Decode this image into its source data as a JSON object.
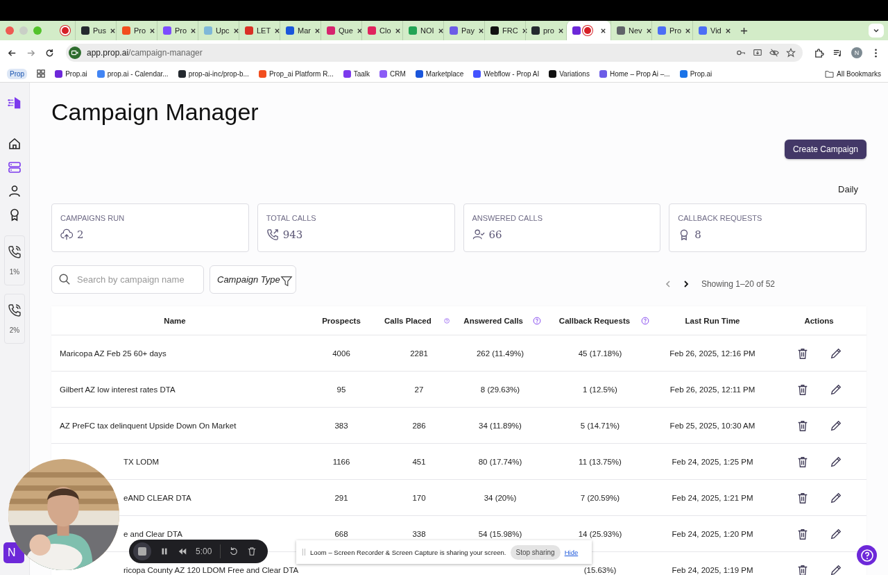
{
  "browser": {
    "tabs": [
      {
        "kind": "recording",
        "selected": false
      },
      {
        "kind": "page",
        "title": "Pus",
        "color": "#24292f",
        "selected": false
      },
      {
        "kind": "page",
        "title": "Pro",
        "color": "#f24e1e",
        "selected": false
      },
      {
        "kind": "page",
        "title": "Pro",
        "color": "#7c4dff",
        "selected": false
      },
      {
        "kind": "page",
        "title": "Upc",
        "color": "#7fb8d8",
        "selected": false
      },
      {
        "kind": "page",
        "title": "LET",
        "color": "#d93025",
        "selected": false
      },
      {
        "kind": "page",
        "title": "Mar",
        "color": "#1a56db",
        "selected": false
      },
      {
        "kind": "page",
        "title": "Que",
        "color": "#d6246e",
        "selected": false
      },
      {
        "kind": "page",
        "title": "Clo",
        "color": "#e0245e",
        "selected": false
      },
      {
        "kind": "page",
        "title": "NOI",
        "color": "#23a455",
        "selected": false
      },
      {
        "kind": "page",
        "title": "Pay",
        "color": "#6c5ce7",
        "selected": false
      },
      {
        "kind": "page",
        "title": "FRC",
        "color": "#111111",
        "selected": false
      },
      {
        "kind": "page",
        "title": "pro",
        "color": "#24292f",
        "selected": false
      },
      {
        "kind": "recording-page",
        "color": "#6d28d9",
        "selected": true
      },
      {
        "kind": "page",
        "title": "Nev",
        "color": "#5f6368",
        "selected": false
      },
      {
        "kind": "page",
        "title": "Pro",
        "color": "#4c6ef5",
        "selected": false
      },
      {
        "kind": "page",
        "title": "Vid",
        "color": "#4c6ef5",
        "selected": false
      }
    ],
    "address": {
      "host": "app.prop.ai",
      "path": "/campaign-manager"
    },
    "profile": "N",
    "bookmarks": [
      {
        "kind": "group",
        "title": "Prop"
      },
      {
        "kind": "apps"
      },
      {
        "kind": "link",
        "title": "Prop.ai",
        "color": "#6d28d9"
      },
      {
        "kind": "link",
        "title": "prop.ai - Calendar...",
        "color": "#4285f4"
      },
      {
        "kind": "link",
        "title": "prop-ai-inc/prop-b...",
        "color": "#24292f"
      },
      {
        "kind": "link",
        "title": "Prop_ai Platform R...",
        "color": "#f24e1e"
      },
      {
        "kind": "link",
        "title": "Taalk",
        "color": "#7c3aed"
      },
      {
        "kind": "link",
        "title": "CRM",
        "color": "#8b5cf6"
      },
      {
        "kind": "link",
        "title": "Marketplace",
        "color": "#1a56db"
      },
      {
        "kind": "link",
        "title": "Webflow - Prop AI",
        "color": "#4353ff"
      },
      {
        "kind": "link",
        "title": "Variations",
        "color": "#111111"
      },
      {
        "kind": "link",
        "title": "Home – Prop Ai –...",
        "color": "#6c5ce7"
      },
      {
        "kind": "link",
        "title": "Prop.ai",
        "color": "#1a73e8"
      }
    ],
    "all_bookmarks": "All Bookmarks"
  },
  "sidebar": {
    "items": [
      {
        "kind": "home",
        "selected": false
      },
      {
        "kind": "campaigns",
        "selected": true
      },
      {
        "kind": "person",
        "selected": false
      },
      {
        "kind": "award",
        "selected": false
      }
    ],
    "usage": [
      {
        "value": "1%"
      },
      {
        "value": "2%"
      }
    ]
  },
  "page": {
    "title": "Campaign Manager",
    "create_button": "Create Campaign",
    "period": "Daily",
    "stats": [
      {
        "kind": "upload",
        "label": "CAMPAIGNS RUN",
        "value": "2"
      },
      {
        "kind": "phone",
        "label": "TOTAL CALLS",
        "value": "943"
      },
      {
        "kind": "person-check",
        "label": "ANSWERED CALLS",
        "value": "66"
      },
      {
        "kind": "award",
        "label": "CALLBACK REQUESTS",
        "value": "8"
      }
    ],
    "search": {
      "placeholder": "Search by campaign name"
    },
    "filter": "Campaign Type",
    "pagination": {
      "prev_disabled": true,
      "summary": "Showing 1–20 of 52"
    }
  },
  "table": {
    "columns": [
      {
        "label": "Name",
        "help": false
      },
      {
        "label": "Prospects",
        "help": false
      },
      {
        "label": "Calls Placed",
        "help": true
      },
      {
        "label": "Answered Calls",
        "help": true
      },
      {
        "label": "Callback Requests",
        "help": true
      },
      {
        "label": "Last Run Time",
        "help": false
      },
      {
        "label": "Actions",
        "help": false
      }
    ],
    "rows": [
      {
        "name": "Maricopa AZ Feb 25 60+ days",
        "prospects": "4006",
        "calls": "2281",
        "answered": "262 (11.49%)",
        "callbacks": "45 (17.18%)",
        "last_run": "Feb 26, 2025, 12:16 PM",
        "behind_camera": false
      },
      {
        "name": "Gilbert AZ low interest rates DTA",
        "prospects": "95",
        "calls": "27",
        "answered": "8 (29.63%)",
        "callbacks": "1 (12.5%)",
        "last_run": "Feb 26, 2025, 12:11 PM",
        "behind_camera": false
      },
      {
        "name": "AZ PreFC tax delinquent Upside Down On Market",
        "prospects": "383",
        "calls": "286",
        "answered": "34 (11.89%)",
        "callbacks": "5 (14.71%)",
        "last_run": "Feb 25, 2025, 10:30 AM",
        "behind_camera": false
      },
      {
        "name": "TX LODM",
        "prospects": "1166",
        "calls": "451",
        "answered": "80 (17.74%)",
        "callbacks": "11 (13.75%)",
        "last_run": "Feb 24, 2025, 1:25 PM",
        "behind_camera": true
      },
      {
        "name": "eAND CLEAR DTA",
        "prospects": "291",
        "calls": "170",
        "answered": "34 (20%)",
        "callbacks": "7 (20.59%)",
        "last_run": "Feb 24, 2025, 1:21 PM",
        "behind_camera": true
      },
      {
        "name": "e and Clear DTA",
        "prospects": "668",
        "calls": "338",
        "answered": "54 (15.98%)",
        "callbacks": "14 (25.93%)",
        "last_run": "Feb 24, 2025, 1:20 PM",
        "behind_camera": true
      },
      {
        "name": "ricopa County AZ 120 LDOM Free and Clear DTA",
        "callbacks": "(15.63%)",
        "last_run": "Feb 24, 2025, 1:19 PM",
        "behind_camera": true
      }
    ]
  },
  "launcher": "N",
  "recorder": {
    "time": "5:00"
  },
  "sharing": {
    "message": "Loom – Screen Recorder & Screen Capture is sharing your screen.",
    "stop": "Stop sharing",
    "hide": "Hide"
  }
}
